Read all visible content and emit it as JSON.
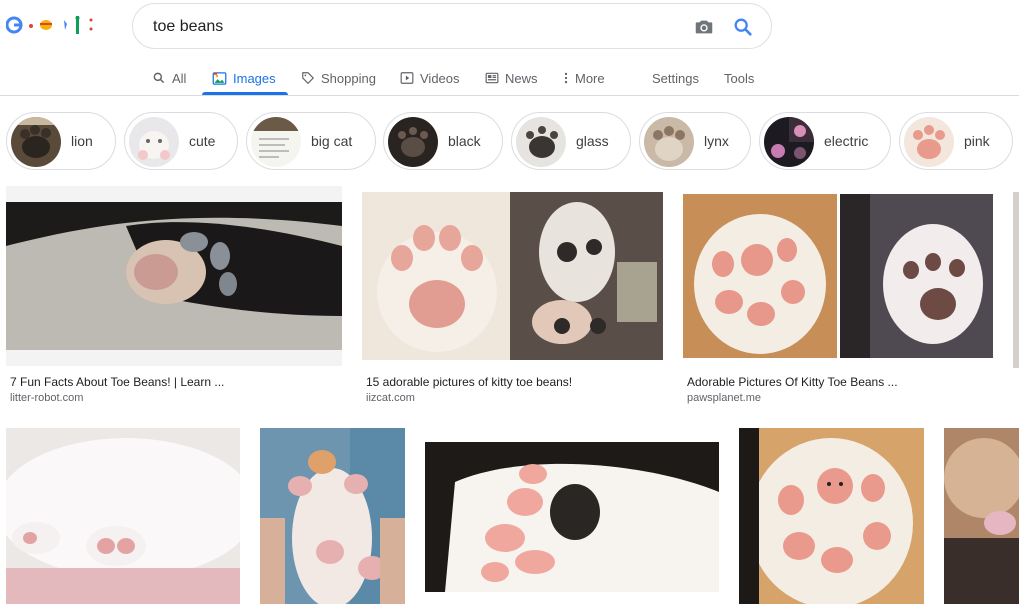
{
  "search": {
    "query": "toe beans"
  },
  "tabs": [
    {
      "label": "All"
    },
    {
      "label": "Images"
    },
    {
      "label": "Shopping"
    },
    {
      "label": "Videos"
    },
    {
      "label": "News"
    },
    {
      "label": "More"
    },
    {
      "label": "Settings"
    },
    {
      "label": "Tools"
    }
  ],
  "chips": [
    {
      "label": "lion"
    },
    {
      "label": "cute"
    },
    {
      "label": "big cat"
    },
    {
      "label": "black"
    },
    {
      "label": "glass"
    },
    {
      "label": "lynx"
    },
    {
      "label": "electric"
    },
    {
      "label": "pink"
    }
  ],
  "results_row1": [
    {
      "caption": "7 Fun Facts About Toe Beans! | Learn ...",
      "source": "litter-robot.com"
    },
    {
      "caption": "15 adorable pictures of kitty toe beans!",
      "source": "iizcat.com"
    },
    {
      "caption": "Adorable Pictures Of Kitty Toe Beans ...",
      "source": "pawsplanet.me"
    }
  ],
  "colors": {
    "accent": "#1a73e8",
    "text": "#202124",
    "muted": "#5f6368",
    "border": "#dadce0"
  }
}
